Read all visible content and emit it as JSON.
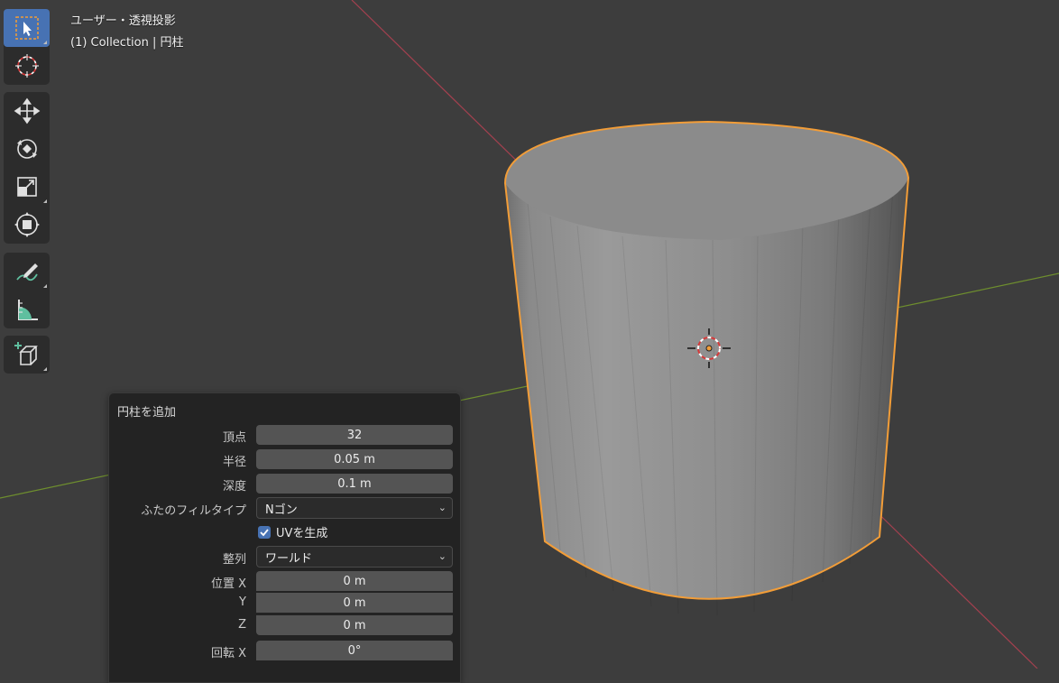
{
  "viewport": {
    "title": "ユーザー・透視投影",
    "collection": "(1) Collection | 円柱"
  },
  "toolbar": {
    "tools": [
      {
        "name": "select-box",
        "icon": "select-box-icon",
        "active": true
      },
      {
        "name": "cursor",
        "icon": "3d-cursor-icon"
      },
      {
        "name": "move",
        "icon": "move-icon"
      },
      {
        "name": "rotate",
        "icon": "rotate-icon"
      },
      {
        "name": "scale",
        "icon": "scale-icon"
      },
      {
        "name": "transform",
        "icon": "transform-icon"
      },
      {
        "name": "annotate",
        "icon": "annotate-icon"
      },
      {
        "name": "measure",
        "icon": "measure-icon"
      },
      {
        "name": "add-cube",
        "icon": "add-cube-icon"
      }
    ]
  },
  "operator_panel": {
    "title": "円柱を追加",
    "vertices": {
      "label": "頂点",
      "value": "32"
    },
    "radius": {
      "label": "半径",
      "value": "0.05 m"
    },
    "depth": {
      "label": "深度",
      "value": "0.1 m"
    },
    "cap_fill": {
      "label": "ふたのフィルタイプ",
      "value": "Nゴン"
    },
    "generate_uv": {
      "label": "UVを生成",
      "checked": true
    },
    "align": {
      "label": "整列",
      "value": "ワールド"
    },
    "location": {
      "label": "位置 X",
      "y_label": "Y",
      "z_label": "Z",
      "x": "0 m",
      "y": "0 m",
      "z": "0 m"
    },
    "rotation": {
      "label": "回転 X",
      "x": "0°"
    }
  },
  "colors": {
    "background": "#3d3d3d",
    "selection_outline": "#f29d38",
    "x_axis": "#a3404f",
    "y_axis": "#6e8e2e",
    "active_tool": "#4772b3"
  }
}
